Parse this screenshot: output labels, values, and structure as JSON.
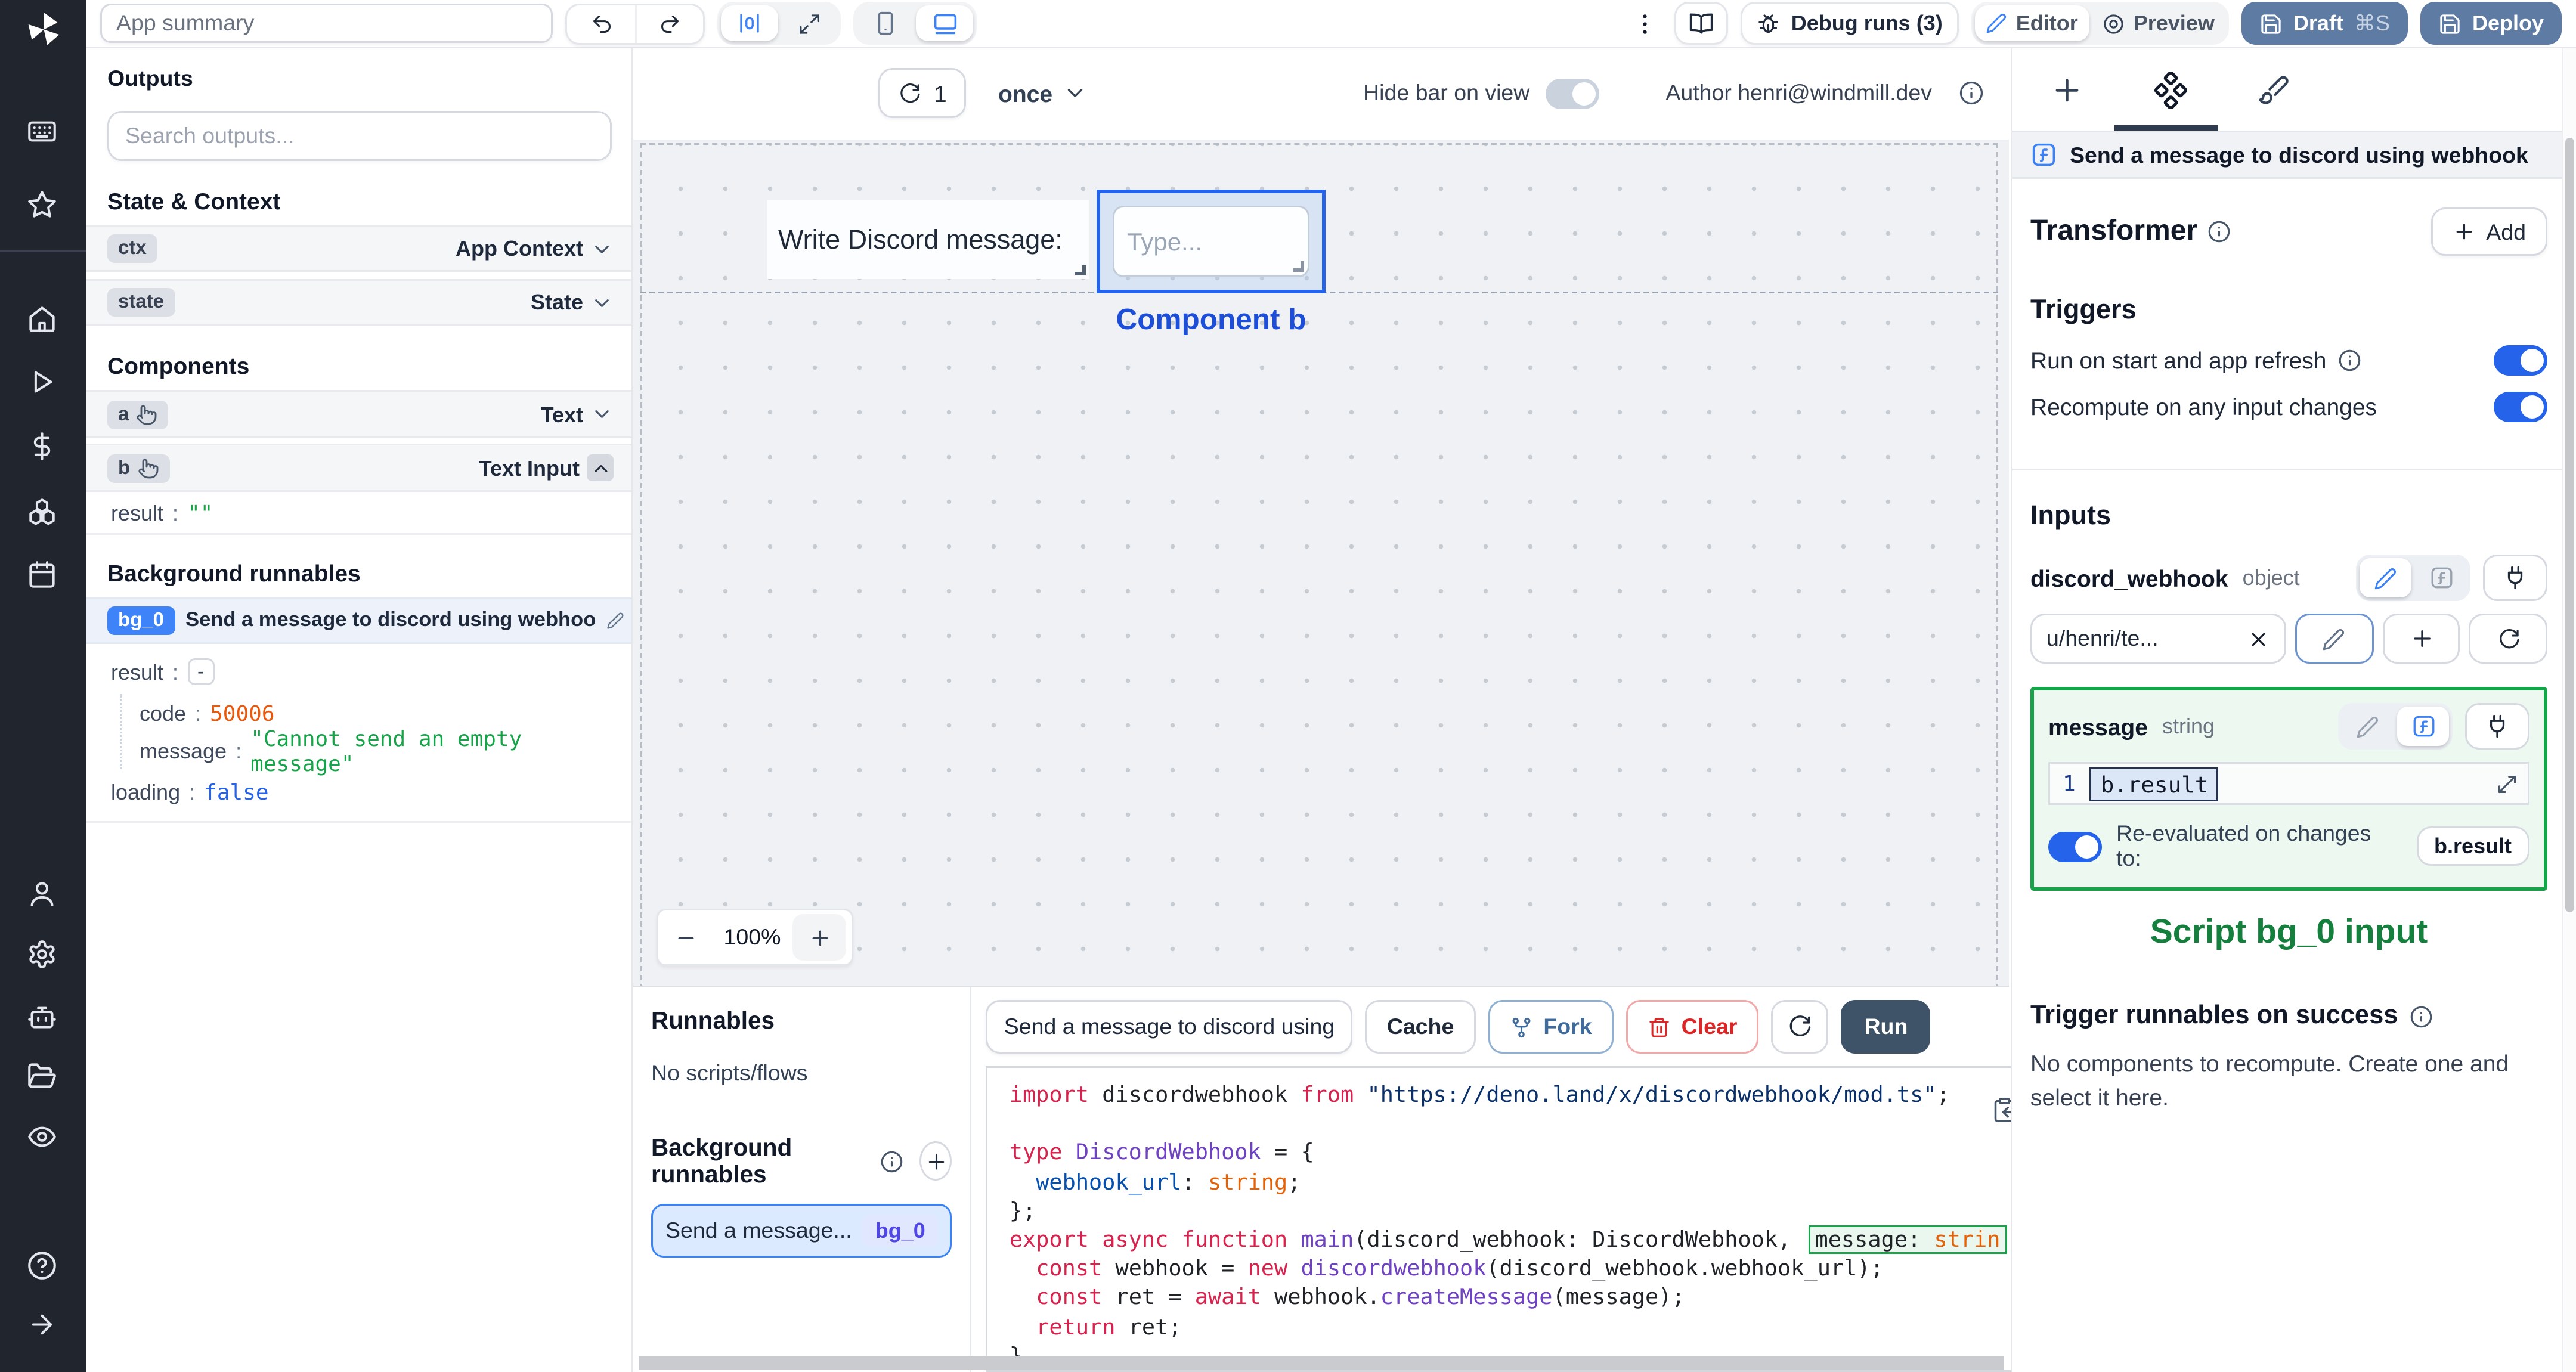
{
  "topbar": {
    "app_summary": "App summary",
    "debug_runs": "Debug runs (3)",
    "editor": "Editor",
    "preview": "Preview",
    "draft": "Draft",
    "draft_shortcut": "⌘S",
    "deploy": "Deploy"
  },
  "canvas_bar": {
    "refresh_count": "1",
    "schedule": "once",
    "hide_bar_label": "Hide bar on view",
    "author": "Author henri@windmill.dev"
  },
  "canvas": {
    "text_component": "Write Discord message:",
    "input_placeholder": "Type...",
    "selected_label": "Component b",
    "zoom_value": "100%"
  },
  "left": {
    "outputs_title": "Outputs",
    "search_placeholder": "Search outputs...",
    "state_context_title": "State & Context",
    "context_rows": [
      {
        "key": "ctx",
        "type": "App Context"
      },
      {
        "key": "state",
        "type": "State"
      }
    ],
    "components_title": "Components",
    "component_rows": [
      {
        "key": "a",
        "type": "Text"
      },
      {
        "key": "b",
        "type": "Text Input"
      }
    ],
    "b_result": {
      "key": "result",
      "value": "\"\""
    },
    "bg_title": "Background runnables",
    "bg_badge": "bg_0",
    "bg_name": "Send a message to discord using webhook",
    "result_key": "result",
    "collapse_glyph": "-",
    "kv": [
      {
        "key": "code",
        "value": "50006"
      },
      {
        "key": "message",
        "value": "\"Cannot send an empty message\""
      },
      {
        "key": "loading",
        "value": "false"
      }
    ]
  },
  "runnables": {
    "title": "Runnables",
    "empty": "No scripts/flows",
    "bg_title": "Background runnables",
    "item_name": "Send a message...",
    "item_badge": "bg_0"
  },
  "editor": {
    "script_name": "Send a message to discord using",
    "cache": "Cache",
    "fork": "Fork",
    "clear": "Clear",
    "run": "Run",
    "code_lines": [
      [
        {
          "c": "kw",
          "t": "import"
        },
        {
          "c": "pl",
          "t": " discordwebhook "
        },
        {
          "c": "kw",
          "t": "from"
        },
        {
          "c": "st",
          "t": " \"https://deno.land/x/discordwebhook/mod.ts\""
        },
        {
          "c": "pl",
          "t": ";"
        }
      ],
      [
        {
          "c": "pl",
          "t": " "
        }
      ],
      [
        {
          "c": "kw",
          "t": "type"
        },
        {
          "c": "pl",
          "t": " "
        },
        {
          "c": "ty",
          "t": "DiscordWebhook"
        },
        {
          "c": "pl",
          "t": " = {"
        }
      ],
      [
        {
          "c": "pl",
          "t": "  "
        },
        {
          "c": "pr",
          "t": "webhook_url"
        },
        {
          "c": "pl",
          "t": ": "
        },
        {
          "c": "bi",
          "t": "string"
        },
        {
          "c": "pl",
          "t": ";"
        }
      ],
      [
        {
          "c": "pl",
          "t": "};"
        }
      ],
      [
        {
          "c": "kw",
          "t": "export"
        },
        {
          "c": "pl",
          "t": " "
        },
        {
          "c": "kw",
          "t": "async"
        },
        {
          "c": "pl",
          "t": " "
        },
        {
          "c": "kw",
          "t": "function"
        },
        {
          "c": "pl",
          "t": " "
        },
        {
          "c": "ty",
          "t": "main"
        },
        {
          "c": "pl",
          "t": "(discord_webhook: DiscordWebhook, "
        },
        {
          "c": "pl",
          "t": "message: ",
          "h": true
        },
        {
          "c": "bi",
          "t": "strin",
          "h": true
        }
      ],
      [
        {
          "c": "pl",
          "t": "  "
        },
        {
          "c": "kw",
          "t": "const"
        },
        {
          "c": "pl",
          "t": " webhook = "
        },
        {
          "c": "kw",
          "t": "new"
        },
        {
          "c": "pl",
          "t": " "
        },
        {
          "c": "ty",
          "t": "discordwebhook"
        },
        {
          "c": "pl",
          "t": "(discord_webhook.webhook_url);"
        }
      ],
      [
        {
          "c": "pl",
          "t": "  "
        },
        {
          "c": "kw",
          "t": "const"
        },
        {
          "c": "pl",
          "t": " ret = "
        },
        {
          "c": "kw",
          "t": "await"
        },
        {
          "c": "pl",
          "t": " webhook."
        },
        {
          "c": "ty",
          "t": "createMessage"
        },
        {
          "c": "pl",
          "t": "(message);"
        }
      ],
      [
        {
          "c": "pl",
          "t": "  "
        },
        {
          "c": "kw",
          "t": "return"
        },
        {
          "c": "pl",
          "t": " ret;"
        }
      ],
      [
        {
          "c": "pl",
          "t": "}"
        }
      ]
    ]
  },
  "right": {
    "header": "Send a message to discord using webhook",
    "transformer_label": "Transformer",
    "add_label": "Add",
    "triggers_title": "Triggers",
    "trigger_rows": [
      {
        "label": "Run on start and app refresh"
      },
      {
        "label": "Recompute on any input changes"
      }
    ],
    "inputs_title": "Inputs",
    "input1": {
      "name": "discord_webhook",
      "type": "object",
      "value": "u/henri/te..."
    },
    "input2": {
      "name": "message",
      "type": "string",
      "line_no": "1",
      "expr": "b.result"
    },
    "reeval_label": "Re-evaluated on changes to:",
    "reeval_target": "b.result",
    "script_input_label": "Script bg_0 input",
    "trigger_success_title": "Trigger runnables on success",
    "no_components_text": "No components to recompute. Create one and select it here."
  },
  "colors": {
    "accent_blue": "#3b82f6",
    "selection_blue": "#2563eb",
    "toggle_on": "#2563eb",
    "draft_deploy_bg": "#5e7ba4",
    "run_button_bg": "#3e5268",
    "green_panel_border": "#17a34a",
    "green_text": "#15803d",
    "error_orange": "#ea580c",
    "string_green": "#17a34a",
    "bool_blue": "#2563eb"
  },
  "icons": {
    "list": [
      "windmill-logo",
      "keyboard",
      "star",
      "home",
      "play",
      "dollar",
      "boxes",
      "calendar",
      "user",
      "gear",
      "bot",
      "folder",
      "eye",
      "help",
      "arrow-right",
      "undo",
      "redo",
      "align-center",
      "maximize",
      "smartphone",
      "laptop",
      "kebab",
      "book",
      "bug",
      "pencil",
      "preview-ring",
      "save",
      "refresh",
      "chevron-down",
      "chevron-up",
      "pointer",
      "info",
      "plus",
      "diamonds",
      "brush",
      "function-square",
      "plug",
      "x",
      "fork",
      "trash",
      "copy",
      "expand",
      "minus"
    ]
  }
}
